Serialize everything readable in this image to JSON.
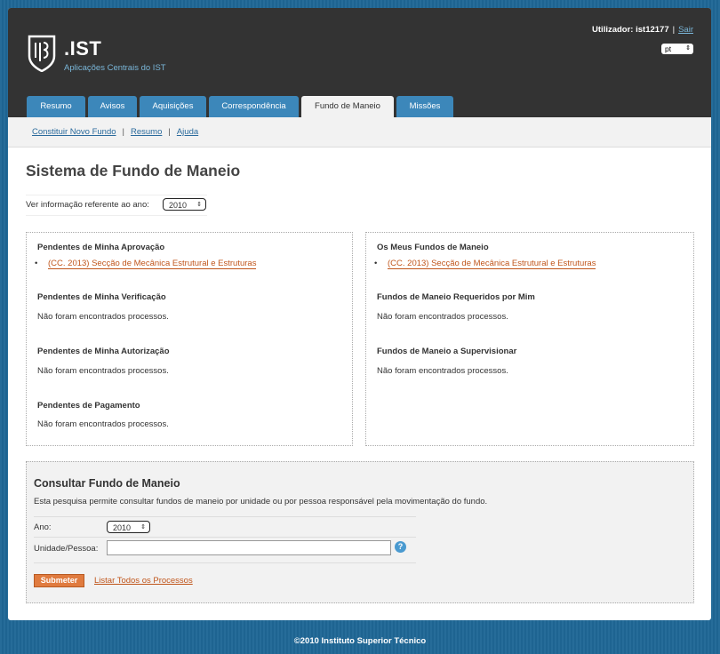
{
  "header": {
    "logo_title": ".IST",
    "logo_subtitle": "Aplicações Centrais do IST",
    "user_label": "Utilizador: ist12177",
    "separator": "|",
    "logout": "Sair",
    "language": "pt"
  },
  "tabs": [
    {
      "label": "Resumo",
      "active": false
    },
    {
      "label": "Avisos",
      "active": false
    },
    {
      "label": "Aquisições",
      "active": false
    },
    {
      "label": "Correspondência",
      "active": false
    },
    {
      "label": "Fundo de Maneio",
      "active": true
    },
    {
      "label": "Missões",
      "active": false
    }
  ],
  "subnav": {
    "items": [
      "Constituir Novo Fundo",
      "Resumo",
      "Ajuda"
    ],
    "separator": "|"
  },
  "main": {
    "title": "Sistema de Fundo de Maneio",
    "year_label": "Ver informação referente ao ano:",
    "year_value": "2010"
  },
  "left_panel": {
    "sections": [
      {
        "heading": "Pendentes de Minha Aprovação",
        "link": "(CC. 2013) Secção de Mecânica Estrutural e Estruturas"
      },
      {
        "heading": "Pendentes de Minha Verificação",
        "text": "Não foram encontrados processos."
      },
      {
        "heading": "Pendentes de Minha Autorização",
        "text": "Não foram encontrados processos."
      },
      {
        "heading": "Pendentes de Pagamento",
        "text": "Não foram encontrados processos."
      }
    ]
  },
  "right_panel": {
    "sections": [
      {
        "heading": "Os Meus Fundos de Maneio",
        "link": "(CC. 2013) Secção de Mecânica Estrutural e Estruturas"
      },
      {
        "heading": "Fundos de Maneio Requeridos por Mim",
        "text": "Não foram encontrados processos."
      },
      {
        "heading": "Fundos de Maneio a Supervisionar",
        "text": "Não foram encontrados processos."
      }
    ]
  },
  "search": {
    "title": "Consultar Fundo de Maneio",
    "description": "Esta pesquisa permite consultar fundos de maneio por unidade ou por pessoa responsável pela movimentação do fundo.",
    "year_label": "Ano:",
    "year_value": "2010",
    "unit_label": "Unidade/Pessoa:",
    "unit_value": "",
    "help": "?",
    "submit": "Submeter",
    "list_all": "Listar Todos os Processos"
  },
  "footer": "©2010 Instituto Superior Técnico",
  "colors": {
    "background": "#1f6796",
    "header": "#333333",
    "tab": "#3c87ba",
    "accent_link": "#c0551b",
    "nav_link": "#2a6a9c",
    "submit": "#e07b3f"
  }
}
